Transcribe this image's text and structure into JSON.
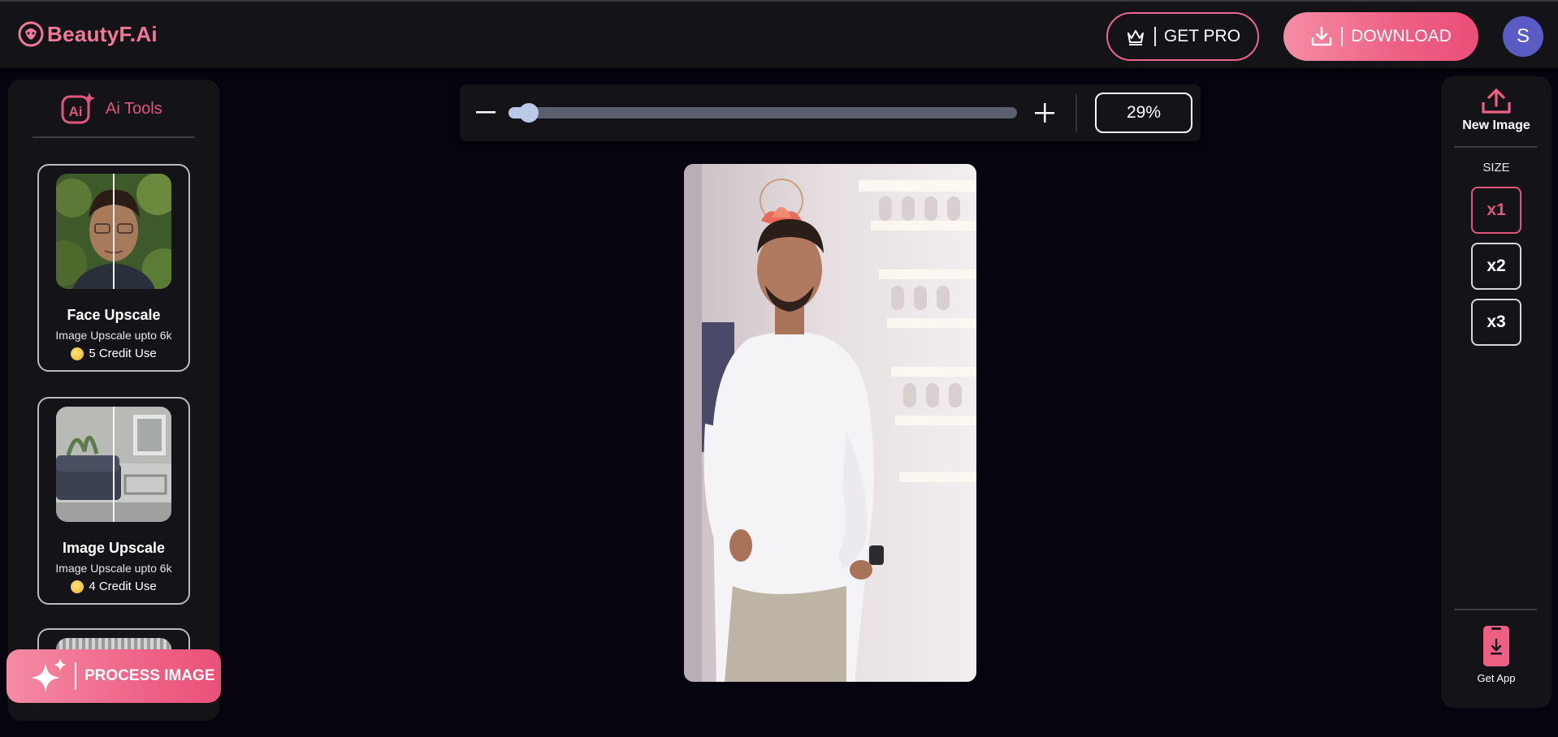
{
  "header": {
    "logo_text": "BeautyF.Ai",
    "get_pro_label": "GET PRO",
    "download_label": "DOWNLOAD",
    "avatar_initial": "S"
  },
  "left_panel": {
    "title": "Ai Tools",
    "tools": [
      {
        "title": "Face Upscale",
        "subtitle": "Image Upscale upto 6k",
        "credits": "5 Credit Use"
      },
      {
        "title": "Image Upscale",
        "subtitle": "Image Upscale upto 6k",
        "credits": "4 Credit Use"
      }
    ],
    "process_label": "PROCESS IMAGE"
  },
  "zoom": {
    "value_label": "29%",
    "slider_fraction": 0.04
  },
  "right_panel": {
    "new_image_label": "New Image",
    "size_label": "SIZE",
    "sizes": [
      "x1",
      "x2",
      "x3"
    ],
    "selected_size": "x1",
    "get_app_label": "Get App"
  },
  "icons": {
    "crown": "crown-icon",
    "download": "download-icon",
    "upload": "upload-icon",
    "sparkle": "sparkle-icon",
    "phone": "phone-download-icon"
  },
  "colors": {
    "accent": "#e2557c",
    "accent_gradient_start": "#f58da5",
    "accent_gradient_end": "#ea4f78",
    "panel": "#141418",
    "background": "#05040f",
    "avatar": "#5a5bc3",
    "slider": "#b9c9e6"
  }
}
